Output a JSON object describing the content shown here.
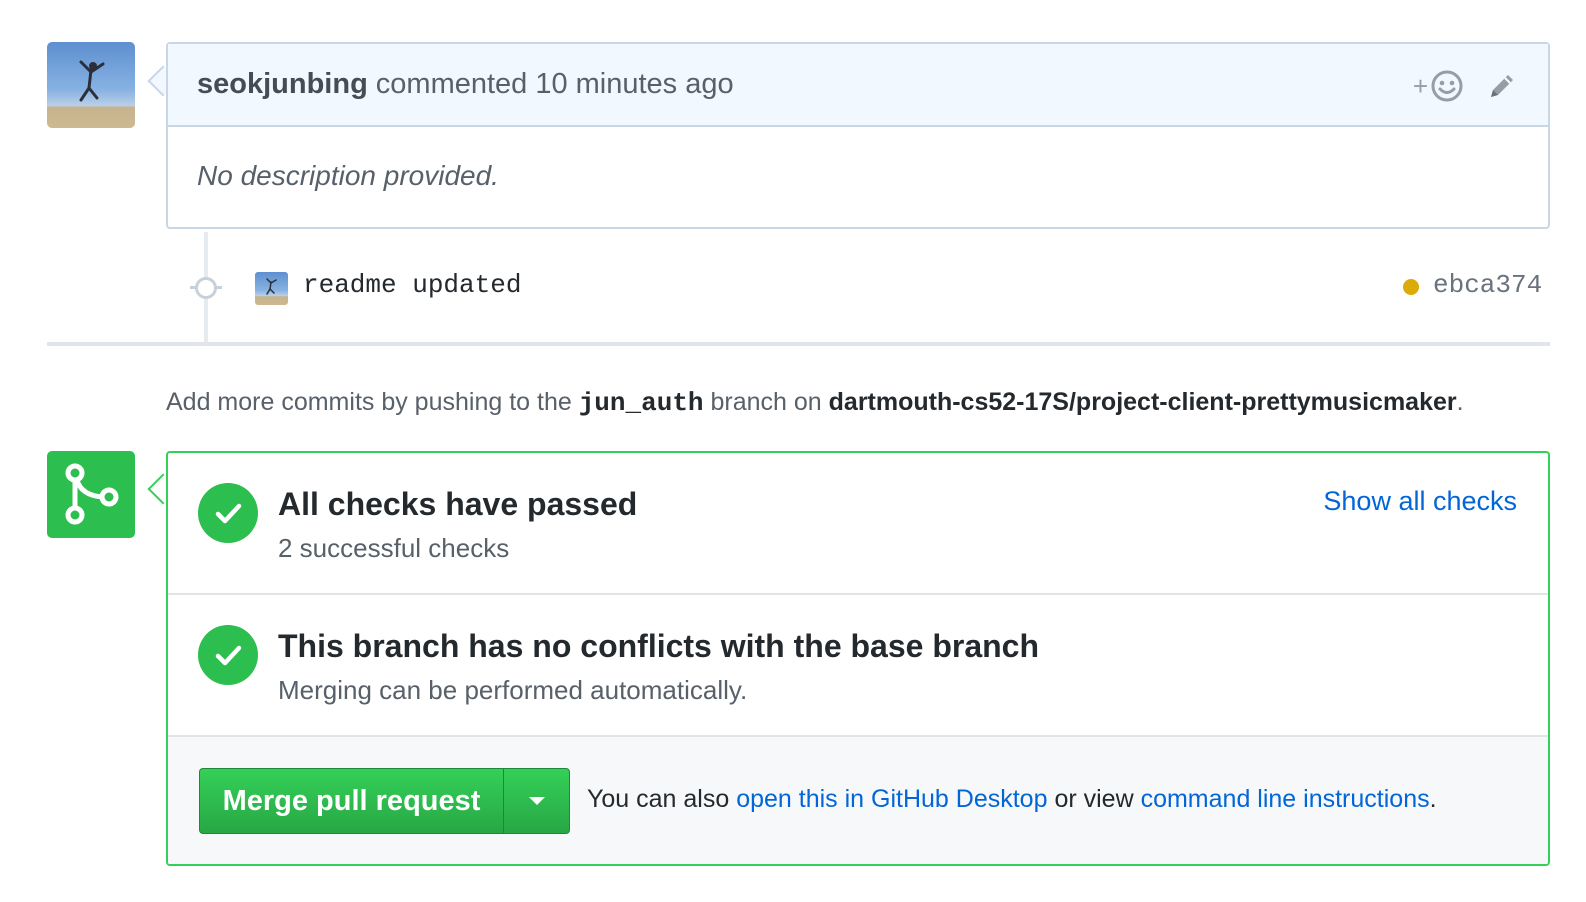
{
  "comment": {
    "author": "seokjunbing",
    "action": "commented",
    "time": "10 minutes ago",
    "react_plus": "+",
    "body": "No description provided."
  },
  "commit": {
    "message": "readme updated",
    "sha": "ebca374",
    "status_color": "#dbab09"
  },
  "push_hint": {
    "prefix": "Add more commits by pushing to the",
    "branch": "jun_auth",
    "middle": "branch on",
    "repo": "dartmouth-cs52-17S/project-client-prettymusicmaker",
    "suffix": "."
  },
  "checks": {
    "title": "All checks have passed",
    "subtitle": "2 successful checks",
    "show_all_label": "Show all checks"
  },
  "conflicts": {
    "title": "This branch has no conflicts with the base branch",
    "subtitle": "Merging can be performed automatically."
  },
  "merge": {
    "button_label": "Merge pull request",
    "note_prefix": "You can also",
    "desktop_link": "open this in GitHub Desktop",
    "note_middle": "or view",
    "cli_link": "command line instructions",
    "note_suffix": "."
  },
  "colors": {
    "success": "#2cbe4e",
    "link": "#0366d6",
    "header_bg": "#f1f8ff"
  },
  "icons": {
    "react": "smiley-icon",
    "edit": "pencil-icon",
    "merge": "git-merge-icon",
    "check": "check-icon",
    "dropdown": "triangle-down-icon"
  }
}
